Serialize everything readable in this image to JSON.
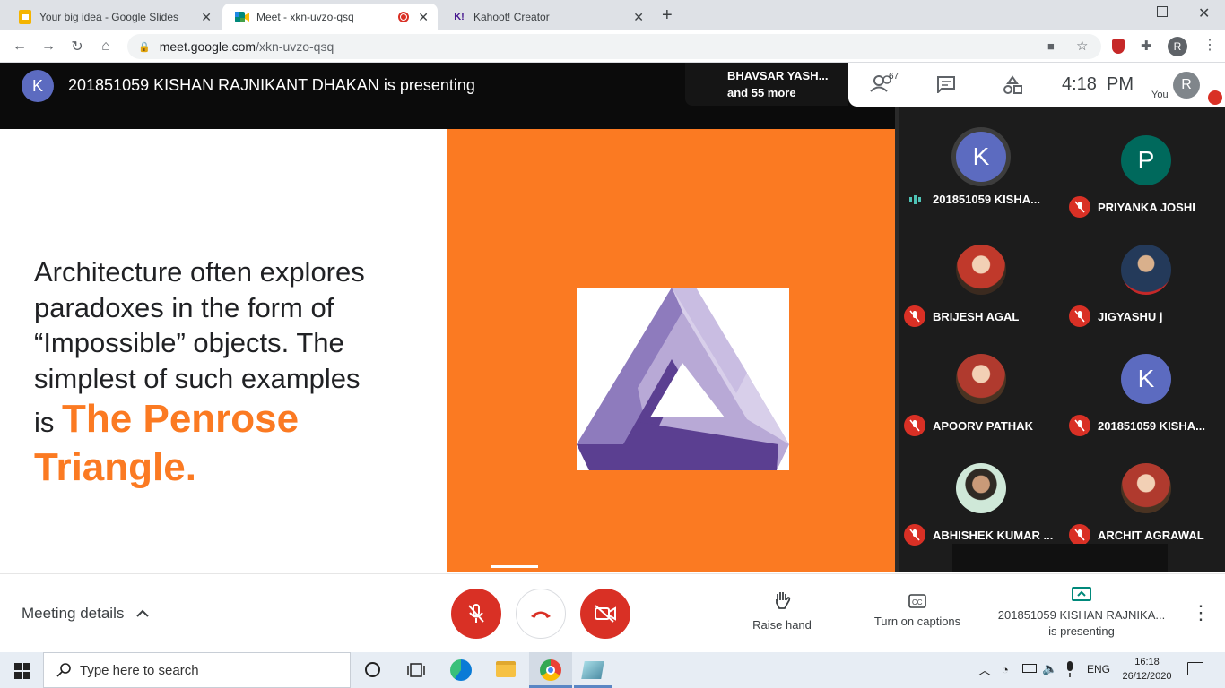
{
  "browser": {
    "tabs": [
      {
        "title": "Your big idea - Google Slides"
      },
      {
        "title": "Meet - xkn-uvzo-qsq"
      },
      {
        "title": "Kahoot! Creator"
      }
    ],
    "url_host": "meet.google.com",
    "url_path": "/xkn-uvzo-qsq",
    "profile_initial": "R"
  },
  "meeting": {
    "presenter_initial": "K",
    "presenting_text": "201851059 KISHAN RAJNIKANT DHAKAN is presenting",
    "others_line1": "BHAVSAR YASH...",
    "others_line2": "and 55 more",
    "participant_count": "67",
    "clock": "4:18  PM",
    "you_label": "You",
    "you_initial": "R"
  },
  "slide": {
    "text_lines": [
      "Architecture often explores",
      "paradoxes in the form of",
      "“Impossible” objects. The",
      "simplest of such examples"
    ],
    "is_word": "is",
    "highlight1": "The Penrose",
    "highlight2": "Triangle."
  },
  "participants": [
    {
      "initial": "K",
      "name": "201851059 KISHA...",
      "avatar_color": "#5c6bc0",
      "speaking": true
    },
    {
      "initial": "P",
      "name": "PRIYANKA JOSHI",
      "avatar_color": "#00695c",
      "speaking": false
    },
    {
      "initial": "",
      "name": "BRIJESH AGAL",
      "avatar_color": "#8d2b1f",
      "speaking": false
    },
    {
      "initial": "",
      "name": "JIGYASHU j",
      "avatar_color": "#2d4a6a",
      "speaking": false
    },
    {
      "initial": "",
      "name": "APOORV PATHAK",
      "avatar_color": "#7a2a1e",
      "speaking": false
    },
    {
      "initial": "K",
      "name": "201851059 KISHA...",
      "avatar_color": "#5c6bc0",
      "speaking": false
    },
    {
      "initial": "",
      "name": "ABHISHEK KUMAR ...",
      "avatar_color": "#3c7a6e",
      "speaking": false
    },
    {
      "initial": "",
      "name": "ARCHIT AGRAWAL",
      "avatar_color": "#7a2a1e",
      "speaking": false
    }
  ],
  "controls": {
    "meeting_details": "Meeting details",
    "raise_hand": "Raise hand",
    "captions": "Turn on captions",
    "presenting_line1": "201851059 KISHAN RAJNIKA...",
    "presenting_line2": "is presenting"
  },
  "taskbar": {
    "search_placeholder": "Type here to search",
    "language": "ENG",
    "time": "16:18",
    "date": "26/12/2020"
  },
  "colors": {
    "slide_orange": "#fb7a22",
    "mic_off_red": "#d93025",
    "meet_dark": "#1c1c1c"
  }
}
